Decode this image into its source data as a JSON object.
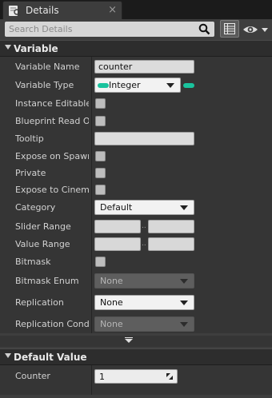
{
  "tab": {
    "label": "Details",
    "close": "×"
  },
  "search": {
    "placeholder": "Search Details",
    "value": ""
  },
  "sections": {
    "variable": "Variable",
    "default_value": "Default Value"
  },
  "properties": {
    "variable_name": {
      "label": "Variable Name",
      "value": "counter"
    },
    "variable_type": {
      "label": "Variable Type",
      "value": "Integer",
      "pin_color": "#19c39d"
    },
    "instance_editable": {
      "label": "Instance Editable",
      "checked": false
    },
    "blueprint_read_only": {
      "label": "Blueprint Read Only",
      "checked": false
    },
    "tooltip": {
      "label": "Tooltip",
      "value": ""
    },
    "expose_on_spawn": {
      "label": "Expose on Spawn",
      "checked": false
    },
    "private": {
      "label": "Private",
      "checked": false
    },
    "expose_to_cinematics": {
      "label": "Expose to Cinematics",
      "checked": false
    },
    "category": {
      "label": "Category",
      "value": "Default"
    },
    "slider_range": {
      "label": "Slider Range",
      "min": "",
      "max": "",
      "separator": ".."
    },
    "value_range": {
      "label": "Value Range",
      "min": "",
      "max": "",
      "separator": ".."
    },
    "bitmask": {
      "label": "Bitmask",
      "checked": false
    },
    "bitmask_enum": {
      "label": "Bitmask Enum",
      "value": "None",
      "enabled": false
    },
    "replication": {
      "label": "Replication",
      "value": "None",
      "enabled": true
    },
    "replication_condition": {
      "label": "Replication Condition",
      "value": "None",
      "enabled": false
    }
  },
  "default_values": {
    "counter": {
      "label": "Counter",
      "value": "1"
    }
  }
}
